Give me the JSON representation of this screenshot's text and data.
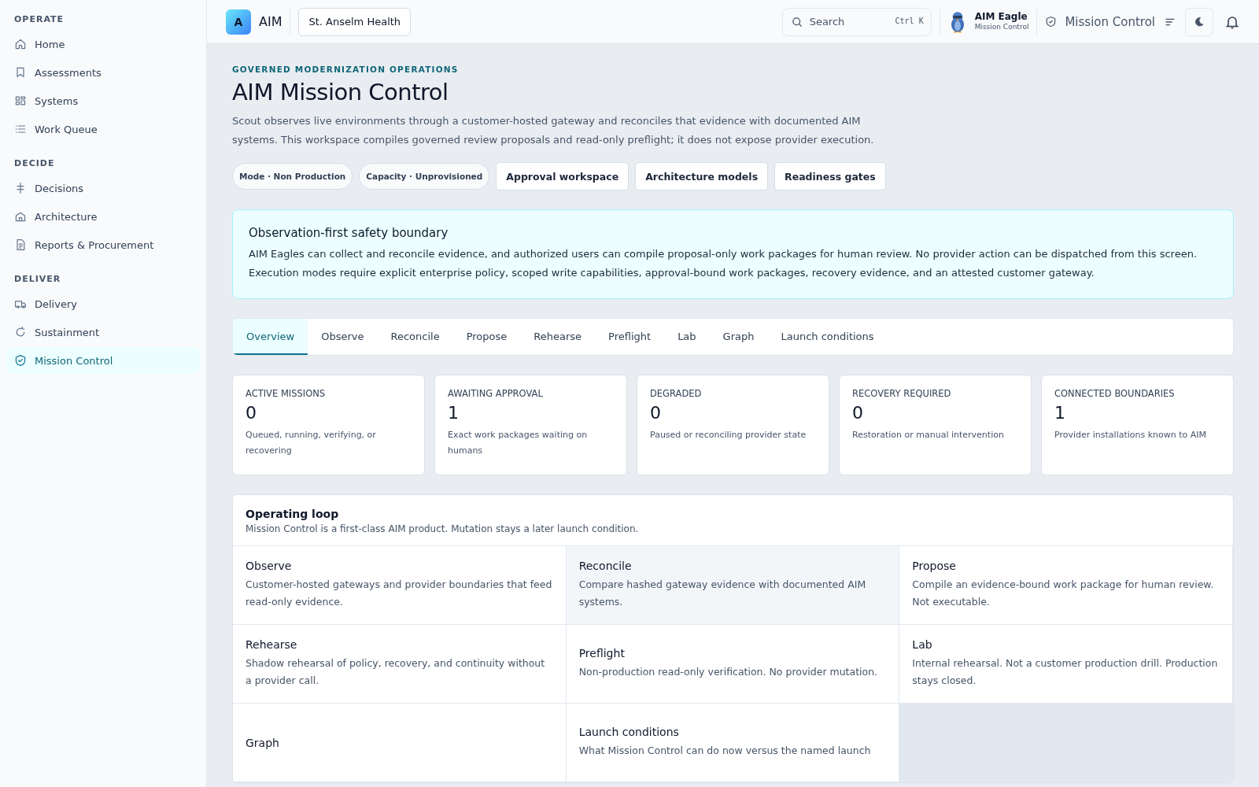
{
  "sidebar": {
    "sections": [
      {
        "heading": "OPERATE",
        "items": [
          {
            "label": "Home",
            "selected": false
          },
          {
            "label": "Assessments",
            "selected": false
          },
          {
            "label": "Systems",
            "selected": false
          },
          {
            "label": "Work Queue",
            "selected": false
          }
        ]
      },
      {
        "heading": "DECIDE",
        "items": [
          {
            "label": "Decisions",
            "selected": false
          },
          {
            "label": "Architecture",
            "selected": false
          },
          {
            "label": "Reports & Procurement",
            "selected": false
          }
        ]
      },
      {
        "heading": "DELIVER",
        "items": [
          {
            "label": "Delivery",
            "selected": false
          },
          {
            "label": "Sustainment",
            "selected": false
          },
          {
            "label": "Mission Control",
            "selected": true
          }
        ]
      }
    ]
  },
  "topbar": {
    "logo_letter": "A",
    "brand": "AIM",
    "organization": "St. Anselm Health",
    "search": {
      "placeholder": "Search",
      "shortcut": "Ctrl K"
    },
    "user": {
      "name": "AIM Eagle",
      "role": "Mission Control"
    },
    "workspace": "Mission Control"
  },
  "header": {
    "eyebrow": "GOVERNED MODERNIZATION OPERATIONS",
    "title": "AIM Mission Control",
    "description": "Scout observes live environments through a customer-hosted gateway and reconciles that evidence with documented AIM systems. This workspace compiles governed review proposals and read-only preflight; it does not expose provider execution.",
    "actions": [
      {
        "kind": "chip",
        "label": "Mode · Non Production"
      },
      {
        "kind": "chip",
        "label": "Capacity · Unprovisioned"
      },
      {
        "kind": "button",
        "label": "Approval workspace"
      },
      {
        "kind": "button",
        "label": "Architecture models"
      },
      {
        "kind": "button",
        "label": "Readiness gates"
      }
    ]
  },
  "notice": {
    "title": "Observation-first safety boundary",
    "text": "AIM Eagles can collect and reconcile evidence, and authorized users can compile proposal-only work packages for human review. No provider action can be dispatched from this screen. Execution modes require explicit enterprise policy, scoped write capabilities, approval-bound work packages, recovery evidence, and an attested customer gateway."
  },
  "tabs": [
    {
      "label": "Overview",
      "selected": true
    },
    {
      "label": "Observe",
      "selected": false
    },
    {
      "label": "Reconcile",
      "selected": false
    },
    {
      "label": "Propose",
      "selected": false
    },
    {
      "label": "Rehearse",
      "selected": false
    },
    {
      "label": "Preflight",
      "selected": false
    },
    {
      "label": "Lab",
      "selected": false
    },
    {
      "label": "Graph",
      "selected": false
    },
    {
      "label": "Launch conditions",
      "selected": false
    }
  ],
  "stats": [
    {
      "label": "ACTIVE MISSIONS",
      "value": "0",
      "note": "Queued, running, verifying, or recovering"
    },
    {
      "label": "AWAITING APPROVAL",
      "value": "1",
      "note": "Exact work packages waiting on humans"
    },
    {
      "label": "DEGRADED",
      "value": "0",
      "note": "Paused or reconciling provider state"
    },
    {
      "label": "RECOVERY REQUIRED",
      "value": "0",
      "note": "Restoration or manual intervention"
    },
    {
      "label": "CONNECTED BOUNDARIES",
      "value": "1",
      "note": "Provider installations known to AIM"
    }
  ],
  "operating_loop": {
    "title": "Operating loop",
    "subtitle": "Mission Control is a first-class AIM product. Mutation stays a later launch condition.",
    "steps": [
      {
        "title": "Observe",
        "text": "Customer-hosted gateways and provider boundaries that feed read-only evidence.",
        "highlighted": false
      },
      {
        "title": "Reconcile",
        "text": "Compare hashed gateway evidence with documented AIM systems.",
        "highlighted": true
      },
      {
        "title": "Propose",
        "text": "Compile an evidence-bound work package for human review. Not executable.",
        "highlighted": false
      },
      {
        "title": "Rehearse",
        "text": "Shadow rehearsal of policy, recovery, and continuity without a provider call.",
        "highlighted": false
      },
      {
        "title": "Preflight",
        "text": "Non-production read-only verification. No provider mutation.",
        "highlighted": false
      },
      {
        "title": "Lab",
        "text": "Internal rehearsal. Not a customer production drill. Production stays closed.",
        "highlighted": false
      },
      {
        "title": "Graph",
        "highlighted": false
      },
      {
        "title": "Launch conditions",
        "text": "What Mission Control can do now versus the named launch",
        "highlighted": false
      }
    ]
  }
}
